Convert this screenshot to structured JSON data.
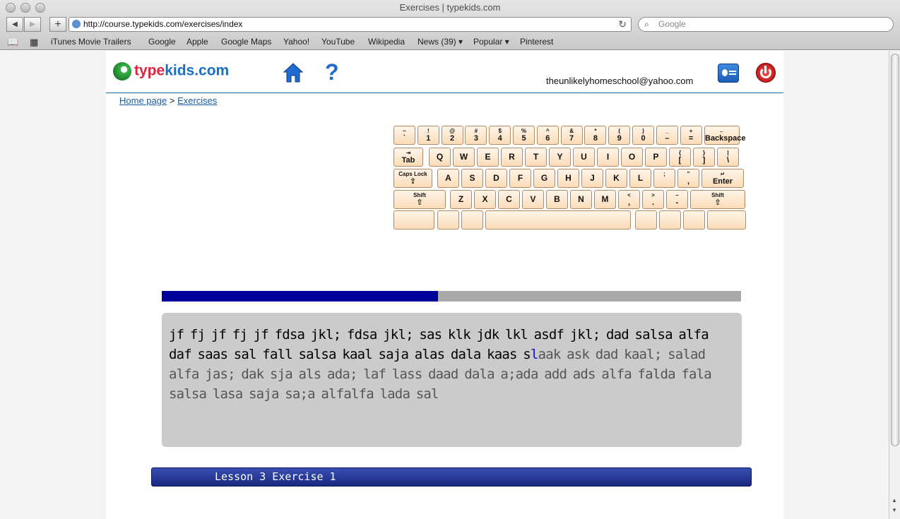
{
  "browser": {
    "title": "Exercises | typekids.com",
    "url": "http://course.typekids.com/exercises/index",
    "search_placeholder": "Google",
    "bookmarks": [
      "iTunes Movie Trailers",
      "Google",
      "Apple",
      "Google Maps",
      "Yahoo!",
      "YouTube",
      "Wikipedia",
      "News (39)",
      "Popular",
      "Pinterest"
    ]
  },
  "site": {
    "logo_type": "type",
    "logo_kids": "kids.com",
    "user_email": "theunlikelyhomeschool@yahoo.com"
  },
  "breadcrumb": {
    "home": "Home page",
    "sep": ">",
    "current": "Exercises"
  },
  "keyboard": {
    "row1": [
      [
        "~",
        "`"
      ],
      [
        "!",
        "1"
      ],
      [
        "@",
        "2"
      ],
      [
        "#",
        "3"
      ],
      [
        "$",
        "4"
      ],
      [
        "%",
        "5"
      ],
      [
        "^",
        "6"
      ],
      [
        "&",
        "7"
      ],
      [
        "*",
        "8"
      ],
      [
        "(",
        "9"
      ],
      [
        ")",
        "0"
      ],
      [
        "_",
        "–"
      ],
      [
        "+",
        "="
      ]
    ],
    "backspace": "Backspace",
    "tab": "Tab",
    "row2": [
      "Q",
      "W",
      "E",
      "R",
      "T",
      "Y",
      "U",
      "I",
      "O",
      "P"
    ],
    "row2_extra": [
      [
        "{",
        "["
      ],
      [
        "}",
        "]"
      ],
      [
        "|",
        "\\"
      ]
    ],
    "caps": "Caps Lock",
    "row3": [
      "A",
      "S",
      "D",
      "F",
      "G",
      "H",
      "J",
      "K",
      "L"
    ],
    "row3_extra": [
      [
        ";",
        ""
      ],
      [
        "\"",
        ","
      ]
    ],
    "enter": "Enter",
    "shift": "Shift",
    "row4": [
      "Z",
      "X",
      "C",
      "V",
      "B",
      "N",
      "M"
    ],
    "row4_extra": [
      [
        "<",
        ","
      ],
      [
        ">",
        "."
      ],
      [
        "–",
        "-"
      ]
    ]
  },
  "exercise": {
    "progress": 0.477,
    "typed_text": "jf fj jf fj jf fdsa jkl; fdsa jkl; sas klk jdk lkl asdf jkl; dad salsa alfa daf saas sal fall salsa kaal saja alas dala kaas s",
    "current_char": "l",
    "remaining_text": "aak ask dad kaal; salad alfa jas; dak sja als ada; laf lass daad dala a;ada add ads alfa falda fala salsa lasa saja sa;a alfalfa lada sal",
    "lesson_label": "Lesson 3 Exercise 1"
  }
}
